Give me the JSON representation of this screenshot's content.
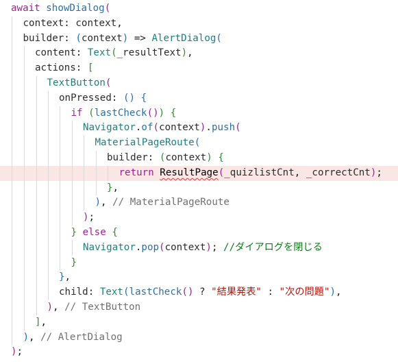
{
  "lines": [
    [
      [
        "kw",
        "await"
      ],
      [
        "pl",
        " "
      ],
      [
        "fn",
        "showDialog"
      ],
      [
        "pa",
        "("
      ]
    ],
    [
      [
        "id",
        "context"
      ],
      [
        "pl",
        ": "
      ],
      [
        "id",
        "context"
      ],
      [
        "pl",
        ","
      ]
    ],
    [
      [
        "id",
        "builder"
      ],
      [
        "pl",
        ": "
      ],
      [
        "pb",
        "("
      ],
      [
        "id",
        "context"
      ],
      [
        "pb",
        ")"
      ],
      [
        "pl",
        " => "
      ],
      [
        "cls",
        "AlertDialog"
      ],
      [
        "pb",
        "("
      ]
    ],
    [
      [
        "id",
        "content"
      ],
      [
        "pl",
        ": "
      ],
      [
        "cls",
        "Text"
      ],
      [
        "pc",
        "("
      ],
      [
        "id",
        "_resultText"
      ],
      [
        "pc",
        ")"
      ],
      [
        "pl",
        ","
      ]
    ],
    [
      [
        "id",
        "actions"
      ],
      [
        "pl",
        ": "
      ],
      [
        "pc",
        "["
      ]
    ],
    [
      [
        "cls",
        "TextButton"
      ],
      [
        "pa",
        "("
      ]
    ],
    [
      [
        "id",
        "onPressed"
      ],
      [
        "pl",
        ": "
      ],
      [
        "pb",
        "()"
      ],
      [
        "pl",
        " "
      ],
      [
        "pb",
        "{"
      ]
    ],
    [
      [
        "kw",
        "if"
      ],
      [
        "pl",
        " "
      ],
      [
        "pc",
        "("
      ],
      [
        "fn",
        "lastCheck"
      ],
      [
        "pa",
        "()"
      ],
      [
        "pc",
        ")"
      ],
      [
        "pl",
        " "
      ],
      [
        "pc",
        "{"
      ]
    ],
    [
      [
        "cls",
        "Navigator"
      ],
      [
        "pl",
        "."
      ],
      [
        "fn",
        "of"
      ],
      [
        "pa",
        "("
      ],
      [
        "id",
        "context"
      ],
      [
        "pa",
        ")"
      ],
      [
        "pl",
        "."
      ],
      [
        "fn",
        "push"
      ],
      [
        "pa",
        "("
      ]
    ],
    [
      [
        "cls",
        "MaterialPageRoute"
      ],
      [
        "pb",
        "("
      ]
    ],
    [
      [
        "id",
        "builder"
      ],
      [
        "pl",
        ": "
      ],
      [
        "pc",
        "("
      ],
      [
        "id",
        "context"
      ],
      [
        "pc",
        ")"
      ],
      [
        "pl",
        " "
      ],
      [
        "pc",
        "{"
      ]
    ],
    [
      [
        "kw",
        "return"
      ],
      [
        "pl",
        " "
      ],
      [
        "err",
        "ResultPage"
      ],
      [
        "pa",
        "("
      ],
      [
        "id",
        "_quizlistCnt"
      ],
      [
        "pl",
        ", "
      ],
      [
        "id",
        "_correctCnt"
      ],
      [
        "pa",
        ")"
      ],
      [
        "pl",
        ";"
      ]
    ],
    [
      [
        "pc",
        "}"
      ],
      [
        "pl",
        ","
      ]
    ],
    [
      [
        "pb",
        ")"
      ],
      [
        "pl",
        ", "
      ],
      [
        "cmt",
        "// MaterialPageRoute"
      ]
    ],
    [
      [
        "pa",
        ")"
      ],
      [
        "pl",
        ";"
      ]
    ],
    [
      [
        "pc",
        "}"
      ],
      [
        "pl",
        " "
      ],
      [
        "kw",
        "else"
      ],
      [
        "pl",
        " "
      ],
      [
        "pc",
        "{"
      ]
    ],
    [
      [
        "cls",
        "Navigator"
      ],
      [
        "pl",
        "."
      ],
      [
        "fn",
        "pop"
      ],
      [
        "pa",
        "("
      ],
      [
        "id",
        "context"
      ],
      [
        "pa",
        ")"
      ],
      [
        "pl",
        "; "
      ],
      [
        "cmtjp",
        "//ダイアログを閉じる"
      ]
    ],
    [
      [
        "pc",
        "}"
      ]
    ],
    [
      [
        "pb",
        "}"
      ],
      [
        "pl",
        ","
      ]
    ],
    [
      [
        "id",
        "child"
      ],
      [
        "pl",
        ": "
      ],
      [
        "cls",
        "Text"
      ],
      [
        "pb",
        "("
      ],
      [
        "fn",
        "lastCheck"
      ],
      [
        "pa",
        "()"
      ],
      [
        "pl",
        " ? "
      ],
      [
        "str",
        "\"結果発表\""
      ],
      [
        "pl",
        " : "
      ],
      [
        "str",
        "\"次の問題\""
      ],
      [
        "pb",
        ")"
      ],
      [
        "pl",
        ","
      ]
    ],
    [
      [
        "pa",
        ")"
      ],
      [
        "pl",
        ", "
      ],
      [
        "cmt",
        "// TextButton"
      ]
    ],
    [
      [
        "pc",
        "]"
      ],
      [
        "pl",
        ","
      ]
    ],
    [
      [
        "pb",
        ")"
      ],
      [
        "pl",
        ", "
      ],
      [
        "cmt",
        "// AlertDialog"
      ]
    ],
    [
      [
        "pa",
        ")"
      ],
      [
        "pl",
        ";"
      ]
    ]
  ]
}
